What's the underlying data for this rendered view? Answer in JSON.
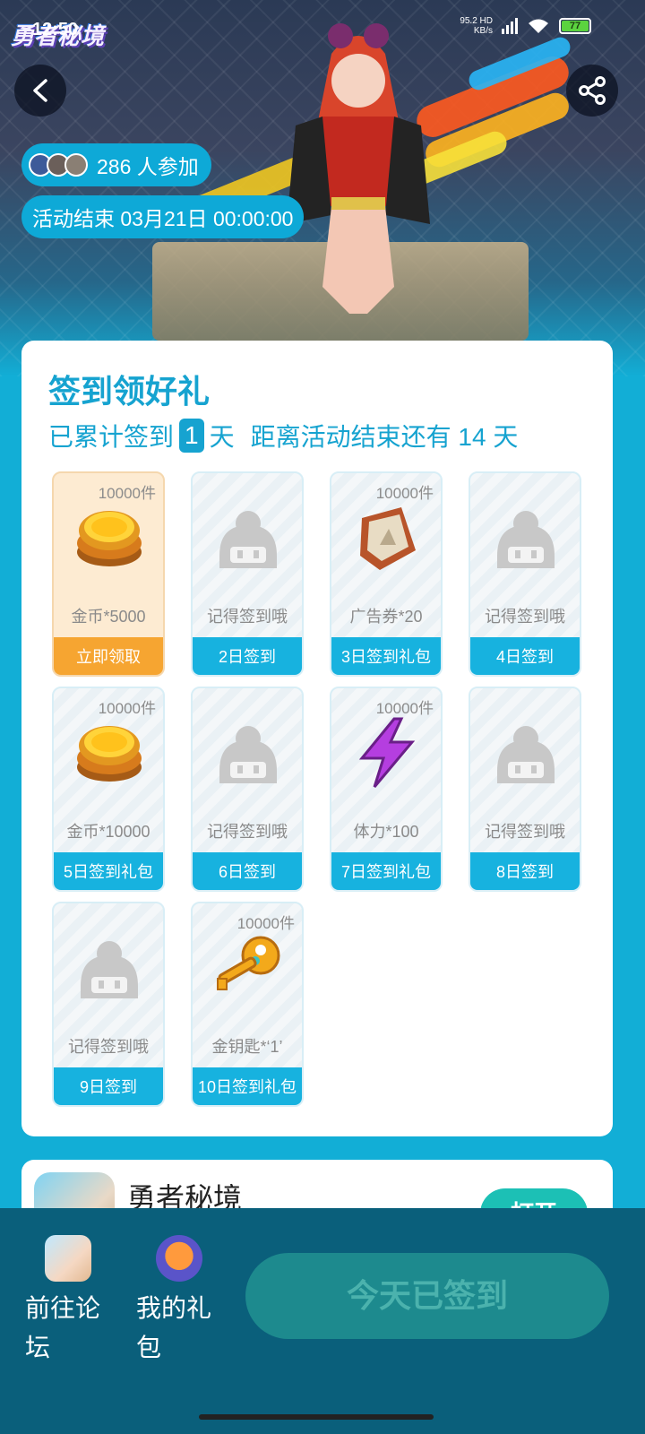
{
  "status_bar": {
    "time": "12:50",
    "net_speed_top": "95.2 HD",
    "net_speed_bottom": "KB/s",
    "battery": "77"
  },
  "app_logo": "勇者秘境",
  "hero": {
    "participants": "286 人参加",
    "end_time": "活动结束 03月21日 00:00:00"
  },
  "card": {
    "title": "签到领好礼",
    "summary_prefix": "已累计签到",
    "checked_days": "1",
    "summary_unit": "天",
    "countdown": "距离活动结束还有 14 天"
  },
  "rewards": [
    {
      "qty": "10000件",
      "name": "金币*5000",
      "foot": "立即领取",
      "icon": "gold-coins-icon",
      "state": "claimable"
    },
    {
      "qty": "",
      "name": "记得签到哦",
      "foot": "2日签到",
      "icon": "placeholder-mascot-icon",
      "state": "locked"
    },
    {
      "qty": "10000件",
      "name": "广告券*20",
      "foot": "3日签到礼包",
      "icon": "ad-ticket-icon",
      "state": "locked"
    },
    {
      "qty": "",
      "name": "记得签到哦",
      "foot": "4日签到",
      "icon": "placeholder-mascot-icon",
      "state": "locked"
    },
    {
      "qty": "10000件",
      "name": "金币*10000",
      "foot": "5日签到礼包",
      "icon": "gold-coins-icon",
      "state": "locked"
    },
    {
      "qty": "",
      "name": "记得签到哦",
      "foot": "6日签到",
      "icon": "placeholder-mascot-icon",
      "state": "locked"
    },
    {
      "qty": "10000件",
      "name": "体力*100",
      "foot": "7日签到礼包",
      "icon": "lightning-icon",
      "state": "locked"
    },
    {
      "qty": "",
      "name": "记得签到哦",
      "foot": "8日签到",
      "icon": "placeholder-mascot-icon",
      "state": "locked"
    },
    {
      "qty": "",
      "name": "记得签到哦",
      "foot": "9日签到",
      "icon": "placeholder-mascot-icon",
      "state": "locked"
    },
    {
      "qty": "10000件",
      "name": "金钥匙*‘1’",
      "foot": "10日签到礼包",
      "icon": "gold-key-icon",
      "state": "locked"
    }
  ],
  "game": {
    "name": "勇者秘境",
    "open_label": "打开"
  },
  "bottom_bar": {
    "forum_label": "前往论坛",
    "gift_label": "我的礼包",
    "checkin_label": "今天已签到"
  },
  "colors": {
    "accent": "#16a3d0",
    "claim": "#f6a531",
    "bottom_bar": "#0a5f7b"
  }
}
